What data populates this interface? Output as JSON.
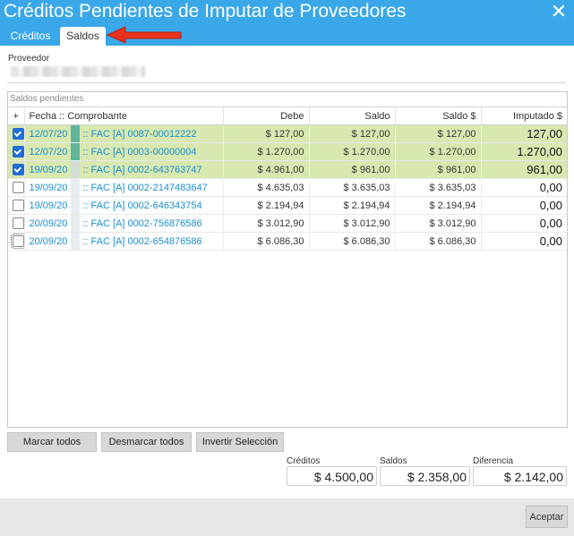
{
  "window": {
    "title": "Créditos Pendientes de Imputar de Proveedores",
    "close_icon": "close-icon"
  },
  "tabs": [
    {
      "label": "Créditos",
      "active": false
    },
    {
      "label": "Saldos",
      "active": true
    }
  ],
  "proveedor": {
    "label": "Proveedor",
    "value_obscured": true
  },
  "grid": {
    "title": "Saldos pendientes",
    "columns": [
      "+",
      "Fecha :: Comprobante",
      "Debe",
      "Saldo",
      "Saldo $",
      "Imputado $"
    ],
    "rows": [
      {
        "checked": true,
        "selected": true,
        "fecha": "12/07/20",
        "comprobante": ":: FAC [A] 0087-00012222",
        "debe": "$ 127,00",
        "saldo": "$ 127,00",
        "saldo_pesos": "$ 127,00",
        "imputado": "127,00"
      },
      {
        "checked": true,
        "selected": true,
        "fecha": "12/07/20",
        "comprobante": ":: FAC [A] 0003-00000004",
        "debe": "$ 1.270,00",
        "saldo": "$ 1.270,00",
        "saldo_pesos": "$ 1.270,00",
        "imputado": "1.270,00"
      },
      {
        "checked": true,
        "selected": true,
        "fecha": "19/09/20",
        "comprobante": ":: FAC [A] 0002-643763747",
        "debe": "$ 4.961,00",
        "saldo": "$ 961,00",
        "saldo_pesos": "$ 961,00",
        "imputado": "961,00"
      },
      {
        "checked": false,
        "selected": false,
        "fecha": "19/09/20",
        "comprobante": ":: FAC [A] 0002-2147483647",
        "debe": "$ 4.635,03",
        "saldo": "$ 3.635,03",
        "saldo_pesos": "$ 3.635,03",
        "imputado": "0,00"
      },
      {
        "checked": false,
        "selected": false,
        "fecha": "19/09/20",
        "comprobante": ":: FAC [A] 0002-646343754",
        "debe": "$ 2.194,94",
        "saldo": "$ 2.194,94",
        "saldo_pesos": "$ 2.194,94",
        "imputado": "0,00"
      },
      {
        "checked": false,
        "selected": false,
        "fecha": "20/09/20",
        "comprobante": ":: FAC [A] 0002-756876586",
        "debe": "$ 3.012,90",
        "saldo": "$ 3.012,90",
        "saldo_pesos": "$ 3.012,90",
        "imputado": "0,00"
      },
      {
        "checked": false,
        "selected": false,
        "focused": true,
        "fecha": "20/09/20",
        "comprobante": ":: FAC [A] 0002-654876586",
        "debe": "$ 6.086,30",
        "saldo": "$ 6.086,30",
        "saldo_pesos": "$ 6.086,30",
        "imputado": "0,00"
      }
    ]
  },
  "buttons": {
    "mark_all": "Marcar todos",
    "unmark_all": "Desmarcar todos",
    "invert": "Invertir Selección"
  },
  "totals": {
    "creditos_label": "Créditos",
    "creditos_value": "$ 4.500,00",
    "saldos_label": "Saldos",
    "saldos_value": "$ 2.358,00",
    "diferencia_label": "Diferencia",
    "diferencia_value": "$ 2.142,00"
  },
  "footer": {
    "accept": "Aceptar"
  },
  "colors": {
    "header": "#3aa7e8",
    "row_selected": "#d8e8b0",
    "link": "#1a8fd0",
    "annotation_arrow": "#e8321e"
  }
}
